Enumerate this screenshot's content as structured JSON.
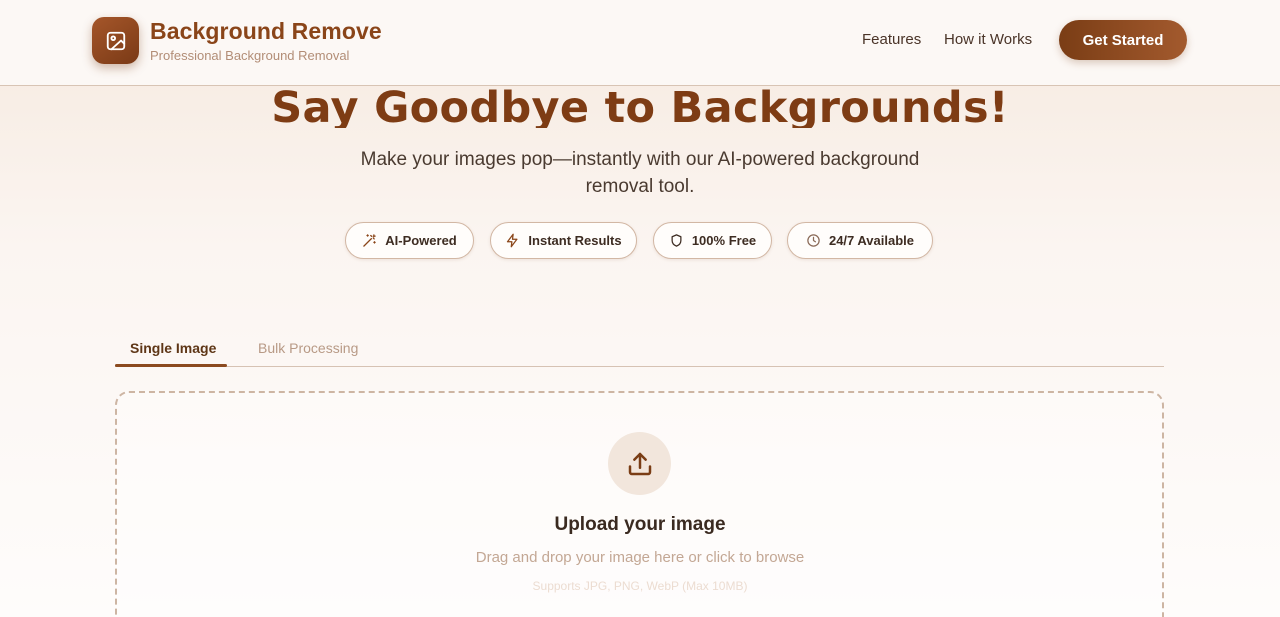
{
  "header": {
    "brand_title": "Background Remove",
    "brand_subtitle": "Professional Background Removal",
    "nav": [
      "Features",
      "How it Works"
    ],
    "cta_label": "Get Started"
  },
  "hero": {
    "title": "Say Goodbye to Backgrounds!",
    "subtitle": "Make your images pop—instantly with our AI-powered background removal tool."
  },
  "badges": [
    {
      "label": "AI-Powered",
      "icon": "magic-wand-icon"
    },
    {
      "label": "Instant Results",
      "icon": "lightning-icon"
    },
    {
      "label": "100% Free",
      "icon": "shield-icon"
    },
    {
      "label": "24/7 Available",
      "icon": "clock-icon"
    }
  ],
  "tabs": [
    {
      "label": "Single Image",
      "active": true
    },
    {
      "label": "Bulk Processing",
      "active": false
    }
  ],
  "upload": {
    "icon": "upload-icon",
    "title": "Upload your image",
    "hint": "Drag and drop your image here or click to browse",
    "note": "Supports JPG, PNG, WebP (Max 10MB)"
  },
  "colors": {
    "brand": "#8a4519",
    "accent_dark": "#7a3d15",
    "accent_light": "#a35a2e"
  }
}
